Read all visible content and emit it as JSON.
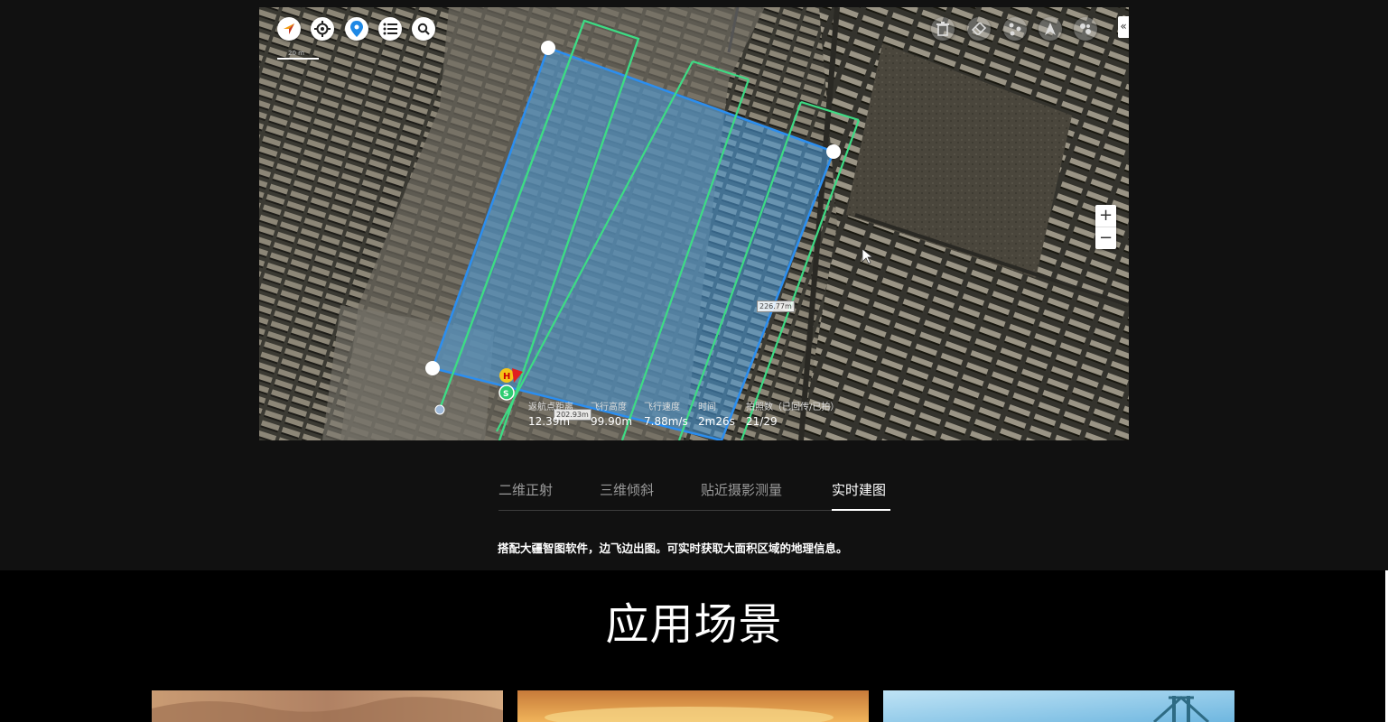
{
  "map": {
    "scale_text": "20 m",
    "toolbar_left": [
      {
        "name": "compass-icon"
      },
      {
        "name": "locate-icon"
      },
      {
        "name": "map-pin-icon"
      },
      {
        "name": "list-icon"
      },
      {
        "name": "search-icon"
      }
    ],
    "toolbar_right": [
      {
        "name": "trash-icon"
      },
      {
        "name": "eraser-icon"
      },
      {
        "name": "waypoints-icon"
      },
      {
        "name": "drone-icon"
      },
      {
        "name": "layers-icon"
      }
    ],
    "collapse_label": "«",
    "zoom_in_label": "+",
    "zoom_out_label": "−",
    "measure_right": "226.77m",
    "measure_bottom": "202.93m",
    "home_marker": "H",
    "start_marker": "S",
    "colors": {
      "area_fill": "#4a9ee0",
      "area_stroke": "#2b8ef0",
      "route": "#3ddc84"
    }
  },
  "stats": [
    {
      "label": "返航点距离",
      "value": "12.39m"
    },
    {
      "label": "飞行高度",
      "value": "99.90m"
    },
    {
      "label": "飞行速度",
      "value": "7.88m/s"
    },
    {
      "label": "时间",
      "value": "2m26s"
    },
    {
      "label": "拍照数（已回传/已拍）",
      "value": "21/29"
    }
  ],
  "tabs": [
    {
      "label": "二维正射",
      "active": false
    },
    {
      "label": "三维倾斜",
      "active": false
    },
    {
      "label": "贴近摄影测量",
      "active": false
    },
    {
      "label": "实时建图",
      "active": true
    }
  ],
  "description": "搭配大疆智图软件，边飞边出图。可实时获取大面积区域的地理信息。",
  "section_title": "应用场景",
  "cards": [
    {
      "name": "desert-card"
    },
    {
      "name": "sunset-card"
    },
    {
      "name": "bridge-card"
    }
  ]
}
